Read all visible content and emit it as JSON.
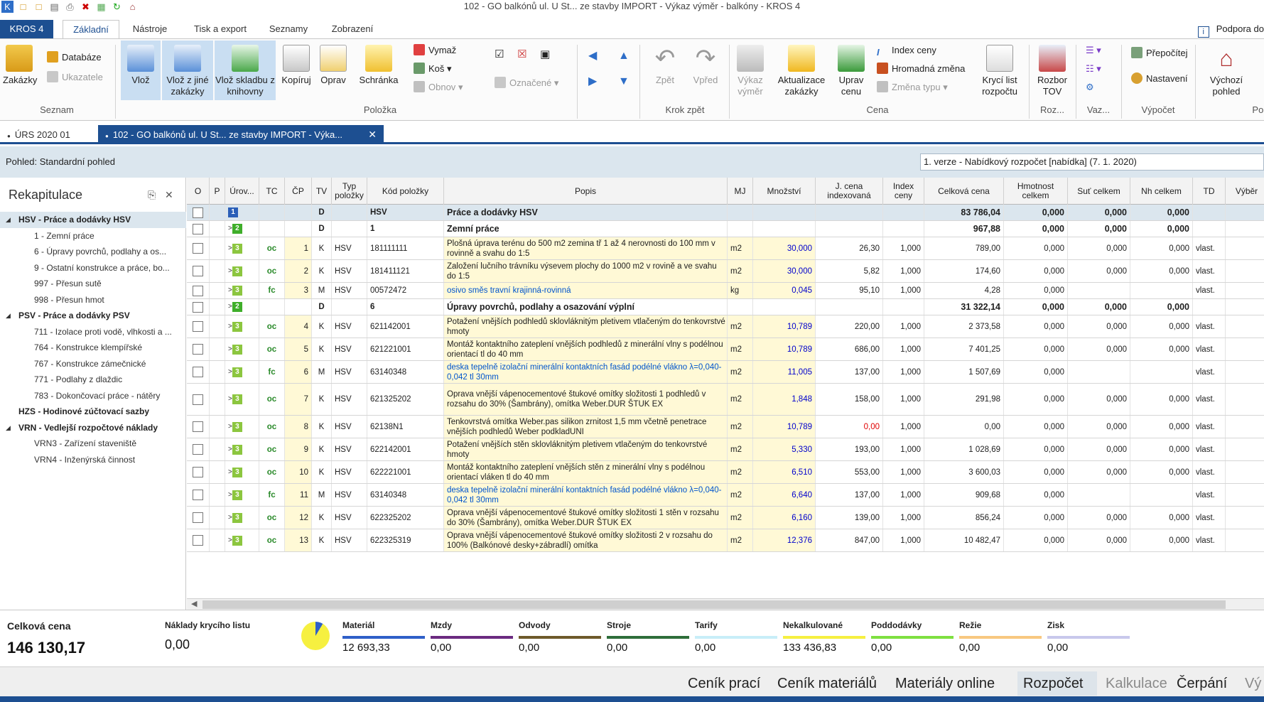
{
  "window": {
    "title": "102 - GO balkónů ul. U St... ze stavby IMPORT - Výkaz výměr - balkóny - KROS 4"
  },
  "menu": {
    "app": "KROS 4",
    "tabs": [
      "Základní",
      "Nástroje",
      "Tisk a export",
      "Seznamy",
      "Zobrazení"
    ],
    "support": "Podpora do"
  },
  "ribbon": {
    "zakazky": "Zakázky",
    "databaze": "Databáze",
    "ukazatele": "Ukazatele",
    "vloz": "Vlož",
    "vloz_zakazky": "Vlož z jiné zakázky",
    "vloz_skladbu": "Vlož skladbu z knihovny",
    "kopiruj": "Kopíruj",
    "oprav": "Oprav",
    "schranka": "Schránka",
    "vymaz": "Vymaž",
    "kos": "Koš",
    "obnov": "Obnov",
    "oznacene": "Označené",
    "zpet": "Zpět",
    "vpred": "Vpřed",
    "vykaz": "Výkaz výměr",
    "aktualizace": "Aktualizace zakázky",
    "uprav_cenu": "Uprav cenu",
    "index_ceny": "Index ceny",
    "hromadna": "Hromadná změna",
    "zmena_typu": "Změna typu",
    "kryci_list": "Krycí list rozpočtu",
    "rozbor": "Rozbor TOV",
    "prepocitej": "Přepočítej",
    "nastaveni": "Nastavení",
    "vychozi": "Výchozí pohled",
    "groups": {
      "seznam": "Seznam",
      "polozka": "Položka",
      "krok": "Krok zpět",
      "cena": "Cena",
      "roz": "Roz...",
      "vaz": "Vaz...",
      "vypocet": "Výpočet",
      "poh": "Poh"
    }
  },
  "doctabs": {
    "tab1": "ÚRS 2020 01",
    "tab2": "102 - GO balkónů ul. U St... ze stavby IMPORT - Výka..."
  },
  "viewbar": {
    "label": "Pohled: Standardní pohled",
    "version": "1. verze - Nabídkový rozpočet [nabídka] (7. 1. 2020)"
  },
  "sidebar": {
    "title": "Rekapitulace",
    "items": [
      {
        "label": "HSV - Práce a dodávky HSV"
      },
      {
        "label": "1 - Zemní práce"
      },
      {
        "label": "6 - Úpravy povrchů, podlahy a os..."
      },
      {
        "label": "9 - Ostatní konstrukce a práce, bo..."
      },
      {
        "label": "997 - Přesun sutě"
      },
      {
        "label": "998 - Přesun hmot"
      },
      {
        "label": "PSV - Práce a dodávky PSV"
      },
      {
        "label": "711 - Izolace proti vodě, vlhkosti a ..."
      },
      {
        "label": "764 - Konstrukce klempířské"
      },
      {
        "label": "767 - Konstrukce zámečnické"
      },
      {
        "label": "771 - Podlahy z dlaždic"
      },
      {
        "label": "783 - Dokončovací práce - nátěry"
      },
      {
        "label": "HZS - Hodinové zúčtovací sazby"
      },
      {
        "label": "VRN - Vedlejší rozpočtové náklady"
      },
      {
        "label": "VRN3 - Zařízení staveniště"
      },
      {
        "label": "VRN4 - Inženýrská činnost"
      }
    ]
  },
  "grid": {
    "headers": [
      "O",
      "P",
      "Úrov...",
      "TC",
      "ČP",
      "TV",
      "Typ položky",
      "Kód položky",
      "Popis",
      "MJ",
      "Množství",
      "J. cena indexovaná",
      "Index ceny",
      "Celková cena",
      "Hmotnost celkem",
      "Suť celkem",
      "Nh celkem",
      "TD",
      "Výběr"
    ],
    "rows": [
      {
        "lvl": "1",
        "tc": "",
        "cp": "",
        "tv": "D",
        "typ": "",
        "kod": "HSV",
        "popis": "Práce a dodávky HSV",
        "mj": "",
        "mnozstvi": "",
        "jcena": "",
        "index": "",
        "celkova": "83 786,04",
        "hmotnost": "0,000",
        "sut": "0,000",
        "nh": "0,000",
        "td": ""
      },
      {
        "lvl": "2",
        "tc": "",
        "cp": "",
        "tv": "D",
        "typ": "",
        "kod": "1",
        "popis": "Zemní práce",
        "mj": "",
        "mnozstvi": "",
        "jcena": "",
        "index": "",
        "celkova": "967,88",
        "hmotnost": "0,000",
        "sut": "0,000",
        "nh": "0,000",
        "td": ""
      },
      {
        "lvl": "3",
        "tc": "oc",
        "cp": "1",
        "tv": "K",
        "typ": "HSV",
        "kod": "181111111",
        "popis": "Plošná úprava terénu do 500 m2 zemina tř 1 až 4 nerovnosti do 100 mm v rovinně a svahu do 1:5",
        "mj": "m2",
        "mnozstvi": "30,000",
        "jcena": "26,30",
        "index": "1,000",
        "celkova": "789,00",
        "hmotnost": "0,000",
        "sut": "0,000",
        "nh": "0,000",
        "td": "vlast."
      },
      {
        "lvl": "3",
        "tc": "oc",
        "cp": "2",
        "tv": "K",
        "typ": "HSV",
        "kod": "181411121",
        "popis": "Založení lučního trávníku výsevem plochy do 1000 m2 v rovině a ve svahu do 1:5",
        "mj": "m2",
        "mnozstvi": "30,000",
        "jcena": "5,82",
        "index": "1,000",
        "celkova": "174,60",
        "hmotnost": "0,000",
        "sut": "0,000",
        "nh": "0,000",
        "td": "vlast."
      },
      {
        "lvl": "3",
        "tc": "fc",
        "cp": "3",
        "tv": "M",
        "typ": "HSV",
        "kod": "00572472",
        "popis": "osivo směs travní krajinná-rovinná",
        "mj": "kg",
        "mnozstvi": "0,045",
        "jcena": "95,10",
        "index": "1,000",
        "celkova": "4,28",
        "hmotnost": "0,000",
        "sut": "",
        "nh": "",
        "td": "vlast."
      },
      {
        "lvl": "2",
        "tc": "",
        "cp": "",
        "tv": "D",
        "typ": "",
        "kod": "6",
        "popis": "Úpravy povrchů, podlahy a osazování výplní",
        "mj": "",
        "mnozstvi": "",
        "jcena": "",
        "index": "",
        "celkova": "31 322,14",
        "hmotnost": "0,000",
        "sut": "0,000",
        "nh": "0,000",
        "td": ""
      },
      {
        "lvl": "3",
        "tc": "oc",
        "cp": "4",
        "tv": "K",
        "typ": "HSV",
        "kod": "621142001",
        "popis": "Potažení vnějších podhledů sklovláknitým pletivem vtlačeným do tenkovrstvé hmoty",
        "mj": "m2",
        "mnozstvi": "10,789",
        "jcena": "220,00",
        "index": "1,000",
        "celkova": "2 373,58",
        "hmotnost": "0,000",
        "sut": "0,000",
        "nh": "0,000",
        "td": "vlast."
      },
      {
        "lvl": "3",
        "tc": "oc",
        "cp": "5",
        "tv": "K",
        "typ": "HSV",
        "kod": "621221001",
        "popis": "Montáž kontaktního zateplení vnějších podhledů z minerální vlny s podélnou orientací tl do 40 mm",
        "mj": "m2",
        "mnozstvi": "10,789",
        "jcena": "686,00",
        "index": "1,000",
        "celkova": "7 401,25",
        "hmotnost": "0,000",
        "sut": "0,000",
        "nh": "0,000",
        "td": "vlast."
      },
      {
        "lvl": "3",
        "tc": "fc",
        "cp": "6",
        "tv": "M",
        "typ": "HSV",
        "kod": "63140348",
        "popis": "deska tepelně izolační minerální kontaktních fasád podélné vlákno λ=0,040-0,042 tl 30mm",
        "mj": "m2",
        "mnozstvi": "11,005",
        "jcena": "137,00",
        "index": "1,000",
        "celkova": "1 507,69",
        "hmotnost": "0,000",
        "sut": "",
        "nh": "",
        "td": "vlast."
      },
      {
        "lvl": "3",
        "tc": "oc",
        "cp": "7",
        "tv": "K",
        "typ": "HSV",
        "kod": "621325202",
        "popis": "Oprava vnější vápenocementové štukové omítky složitosti 1 podhledů v rozsahu do 30% (Šambrány), omítka Weber.DUR ŠTUK EX",
        "mj": "m2",
        "mnozstvi": "1,848",
        "jcena": "158,00",
        "index": "1,000",
        "celkova": "291,98",
        "hmotnost": "0,000",
        "sut": "0,000",
        "nh": "0,000",
        "td": "vlast."
      },
      {
        "lvl": "3",
        "tc": "oc",
        "cp": "8",
        "tv": "K",
        "typ": "HSV",
        "kod": "62138N1",
        "popis": "Tenkovrstvá omítka Weber.pas silikon zrnitost 1,5 mm včetně penetrace vnějších podhledů Weber podkladUNI",
        "mj": "m2",
        "mnozstvi": "10,789",
        "jcena": "0,00",
        "index": "1,000",
        "celkova": "0,00",
        "hmotnost": "0,000",
        "sut": "0,000",
        "nh": "0,000",
        "td": "vlast."
      },
      {
        "lvl": "3",
        "tc": "oc",
        "cp": "9",
        "tv": "K",
        "typ": "HSV",
        "kod": "622142001",
        "popis": "Potažení vnějších stěn sklovláknitým pletivem vtlačeným do tenkovrstvé hmoty",
        "mj": "m2",
        "mnozstvi": "5,330",
        "jcena": "193,00",
        "index": "1,000",
        "celkova": "1 028,69",
        "hmotnost": "0,000",
        "sut": "0,000",
        "nh": "0,000",
        "td": "vlast."
      },
      {
        "lvl": "3",
        "tc": "oc",
        "cp": "10",
        "tv": "K",
        "typ": "HSV",
        "kod": "622221001",
        "popis": "Montáž kontaktního zateplení vnějších stěn z minerální vlny s podélnou orientací vláken tl do 40 mm",
        "mj": "m2",
        "mnozstvi": "6,510",
        "jcena": "553,00",
        "index": "1,000",
        "celkova": "3 600,03",
        "hmotnost": "0,000",
        "sut": "0,000",
        "nh": "0,000",
        "td": "vlast."
      },
      {
        "lvl": "3",
        "tc": "fc",
        "cp": "11",
        "tv": "M",
        "typ": "HSV",
        "kod": "63140348",
        "popis": "deska tepelně izolační minerální kontaktních fasád podélné vlákno λ=0,040-0,042 tl 30mm",
        "mj": "m2",
        "mnozstvi": "6,640",
        "jcena": "137,00",
        "index": "1,000",
        "celkova": "909,68",
        "hmotnost": "0,000",
        "sut": "",
        "nh": "",
        "td": "vlast."
      },
      {
        "lvl": "3",
        "tc": "oc",
        "cp": "12",
        "tv": "K",
        "typ": "HSV",
        "kod": "622325202",
        "popis": "Oprava vnější vápenocementové štukové omítky složitosti 1 stěn v rozsahu do 30% (Šambrány), omítka Weber.DUR ŠTUK EX",
        "mj": "m2",
        "mnozstvi": "6,160",
        "jcena": "139,00",
        "index": "1,000",
        "celkova": "856,24",
        "hmotnost": "0,000",
        "sut": "0,000",
        "nh": "0,000",
        "td": "vlast."
      },
      {
        "lvl": "3",
        "tc": "oc",
        "cp": "13",
        "tv": "K",
        "typ": "HSV",
        "kod": "622325319",
        "popis": "Oprava vnější vápenocementové štukové omítky složitosti 2 v rozsahu do 100% (Balkónové desky+zábradlí) omítka",
        "mj": "m2",
        "mnozstvi": "12,376",
        "jcena": "847,00",
        "index": "1,000",
        "celkova": "10 482,47",
        "hmotnost": "0,000",
        "sut": "0,000",
        "nh": "0,000",
        "td": "vlast."
      }
    ]
  },
  "summary": {
    "total_label": "Celková cena",
    "total": "146 130,17",
    "kryci_label": "Náklady krycího listu",
    "kryci": "0,00",
    "items": [
      {
        "label": "Materiál",
        "value": "12 693,33",
        "color": "#2f5fc8"
      },
      {
        "label": "Mzdy",
        "value": "0,00",
        "color": "#6b2a80"
      },
      {
        "label": "Odvody",
        "value": "0,00",
        "color": "#6e5a2a"
      },
      {
        "label": "Stroje",
        "value": "0,00",
        "color": "#2e6e3a"
      },
      {
        "label": "Tarify",
        "value": "0,00",
        "color": "#c8eef8"
      },
      {
        "label": "Nekalkulované",
        "value": "133 436,83",
        "color": "#f6f040"
      },
      {
        "label": "Poddodávky",
        "value": "0,00",
        "color": "#7ee040"
      },
      {
        "label": "Režie",
        "value": "0,00",
        "color": "#f8c880"
      },
      {
        "label": "Zisk",
        "value": "0,00",
        "color": "#c8c8ec"
      }
    ]
  },
  "bottom_tabs": [
    "Ceník prací",
    "Ceník materiálů",
    "Materiály online",
    "Rozpočet",
    "Kalkulace",
    "Čerpání",
    "Vý"
  ],
  "colors": {
    "accent": "#1d4f91",
    "selected_row": "#dbe6ee",
    "highlight": "#fff9d6",
    "level1": "#2b5fb8",
    "level2": "#3fae2a",
    "level3": "#8cc63f"
  }
}
